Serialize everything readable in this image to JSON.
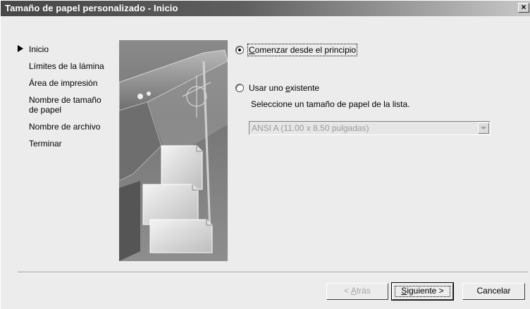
{
  "window": {
    "title": "Tamaño de papel personalizado - Inicio",
    "close_glyph": "×"
  },
  "steps": [
    {
      "label": "Inicio",
      "current": true
    },
    {
      "label": "Límites de la lámina",
      "current": false
    },
    {
      "label": "Área de impresión",
      "current": false
    },
    {
      "label": "Nombre de tamaño de papel",
      "current": false
    },
    {
      "label": "Nombre de archivo",
      "current": false
    },
    {
      "label": "Terminar",
      "current": false
    }
  ],
  "options": {
    "start_new": {
      "label_pre": "",
      "label_u": "C",
      "label_post": "omenzar desde el principio",
      "selected": true
    },
    "use_existing": {
      "label_pre": "Usar uno ",
      "label_u": "e",
      "label_post": "xistente",
      "selected": false
    },
    "hint": "Seleccione un tamaño de papel de la lista.",
    "paper_select": {
      "value": "ANSI A (11.00 x 8.50 pulgadas)",
      "enabled": false
    }
  },
  "buttons": {
    "back": {
      "label_pre": "< ",
      "label_u": "A",
      "label_post": "trás",
      "enabled": false
    },
    "next": {
      "label_u": "S",
      "label_post": "iguiente >",
      "enabled": true
    },
    "cancel": {
      "label": "Cancelar",
      "enabled": true
    }
  },
  "icons": {
    "current_step": "triangle-right-icon",
    "dropdown": "chevron-down-icon",
    "close": "close-icon"
  }
}
